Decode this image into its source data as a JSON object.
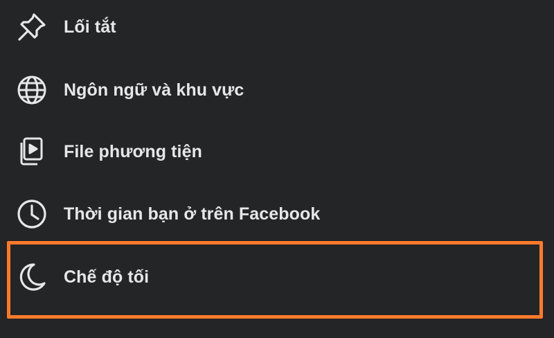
{
  "menu": {
    "items": [
      {
        "label": "Lối tắt",
        "icon": "pin-icon"
      },
      {
        "label": "Ngôn ngữ và khu vực",
        "icon": "globe-icon"
      },
      {
        "label": "File phương tiện",
        "icon": "media-icon"
      },
      {
        "label": "Thời gian bạn ở trên Facebook",
        "icon": "clock-icon"
      },
      {
        "label": "Chế độ tối",
        "icon": "moon-icon"
      }
    ]
  },
  "colors": {
    "background": "#242526",
    "text": "#e6e7ea",
    "icon": "#e6e7ea",
    "highlight": "#ff7a2b"
  }
}
